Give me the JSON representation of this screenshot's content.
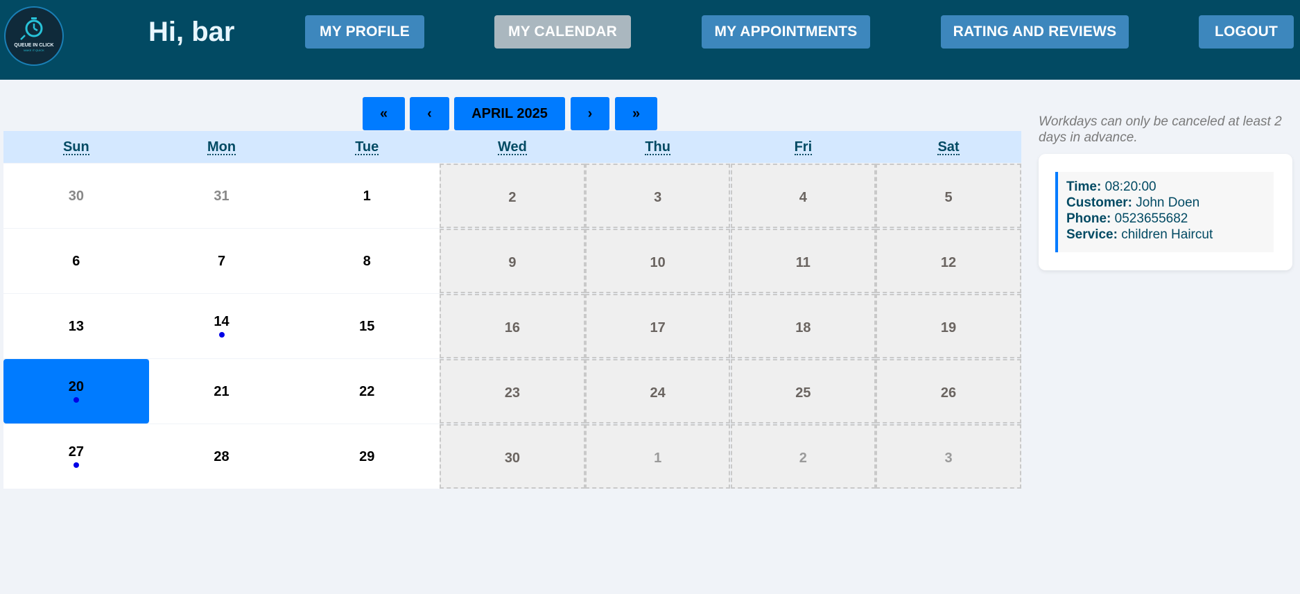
{
  "header": {
    "logo_text": "QUEUE IN CLICK",
    "logo_tagline": "MAKE IT QUICK",
    "greeting": "Hi, bar",
    "nav": [
      {
        "label": "MY PROFILE"
      },
      {
        "label": "MY CALENDAR",
        "active": true
      },
      {
        "label": "MY APPOINTMENTS"
      },
      {
        "label": "RATING AND REVIEWS"
      },
      {
        "label": "LOGOUT"
      }
    ]
  },
  "calendar": {
    "nav": {
      "prev_year": "«",
      "prev_month": "‹",
      "current": "APRIL 2025",
      "next_month": "›",
      "next_year": "»"
    },
    "weekdays": [
      "Sun",
      "Mon",
      "Tue",
      "Wed",
      "Thu",
      "Fri",
      "Sat"
    ],
    "weeks": [
      [
        {
          "d": "30",
          "other": true
        },
        {
          "d": "31",
          "other": true
        },
        {
          "d": "1"
        },
        {
          "d": "2",
          "off": true
        },
        {
          "d": "3",
          "off": true
        },
        {
          "d": "4",
          "off": true
        },
        {
          "d": "5",
          "off": true
        }
      ],
      [
        {
          "d": "6"
        },
        {
          "d": "7"
        },
        {
          "d": "8"
        },
        {
          "d": "9",
          "off": true
        },
        {
          "d": "10",
          "off": true
        },
        {
          "d": "11",
          "off": true
        },
        {
          "d": "12",
          "off": true
        }
      ],
      [
        {
          "d": "13"
        },
        {
          "d": "14",
          "dot": true
        },
        {
          "d": "15"
        },
        {
          "d": "16",
          "off": true
        },
        {
          "d": "17",
          "off": true
        },
        {
          "d": "18",
          "off": true
        },
        {
          "d": "19",
          "off": true
        }
      ],
      [
        {
          "d": "20",
          "dot": true,
          "selected": true
        },
        {
          "d": "21"
        },
        {
          "d": "22"
        },
        {
          "d": "23",
          "off": true
        },
        {
          "d": "24",
          "off": true
        },
        {
          "d": "25",
          "off": true
        },
        {
          "d": "26",
          "off": true
        }
      ],
      [
        {
          "d": "27",
          "dot": true
        },
        {
          "d": "28"
        },
        {
          "d": "29"
        },
        {
          "d": "30",
          "off": true
        },
        {
          "d": "1",
          "off": true,
          "other": true
        },
        {
          "d": "2",
          "off": true,
          "other": true
        },
        {
          "d": "3",
          "off": true,
          "other": true
        }
      ]
    ]
  },
  "side": {
    "note": "Workdays can only be canceled at least 2 days in advance.",
    "appointment": {
      "time_label": "Time:",
      "time": "08:20:00",
      "customer_label": "Customer:",
      "customer": "John Doen",
      "phone_label": "Phone:",
      "phone": "0523655682",
      "service_label": "Service:",
      "service": "children Haircut"
    }
  },
  "colors": {
    "header_bg": "#024a63",
    "nav_button": "#3d87bd",
    "nav_active": "#aab7bf",
    "accent": "#007bff",
    "dot": "#0000e6"
  }
}
